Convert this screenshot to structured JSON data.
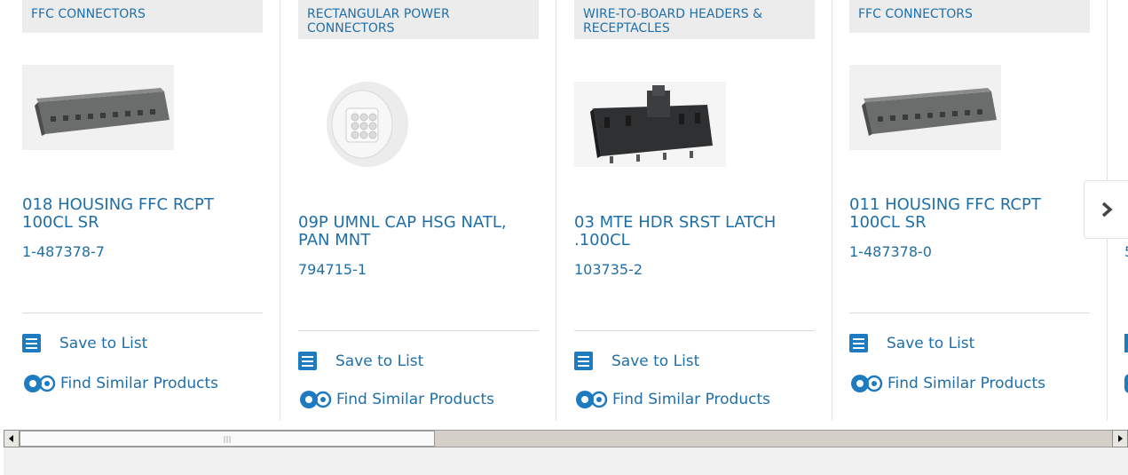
{
  "products": [
    {
      "category": "FFC CONNECTORS",
      "title": "018 HOUSING FFC RCPT 100CL SR",
      "part_number": "1-487378-7",
      "save_label": "Save to List",
      "find_label": "Find Similar Products",
      "image": "ffc-housing-image"
    },
    {
      "category": "RECTANGULAR POWER CONNECTORS",
      "title": "09P UMNL CAP HSG NATL, PAN MNT",
      "part_number": "794715-1",
      "save_label": "Save to List",
      "find_label": "Find Similar Products",
      "image": "round-power-connector-image"
    },
    {
      "category": "WIRE-TO-BOARD HEADERS & RECEPTACLES",
      "title": "03 MTE HDR SRST LATCH .100CL",
      "part_number": "103735-2",
      "save_label": "Save to List",
      "find_label": "Find Similar Products",
      "image": "header-latch-image"
    },
    {
      "category": "FFC CONNECTORS",
      "title": "011 HOUSING FFC RCPT 100CL SR",
      "part_number": "1-487378-0",
      "save_label": "Save to List",
      "find_label": "Find Similar Products",
      "image": "ffc-housing-image"
    }
  ],
  "next_card_partial": {
    "part_number_partial": "5"
  },
  "carousel": {
    "next_icon": "chevron-right-icon"
  },
  "scrollbar": {
    "thumb_fraction": 0.38,
    "left_arrow_icon": "triangle-left-icon",
    "right_arrow_icon": "triangle-right-icon"
  },
  "colors": {
    "link": "#1f6fa8",
    "icon_blue": "#1f7bbf",
    "category_bg": "#ececec"
  }
}
